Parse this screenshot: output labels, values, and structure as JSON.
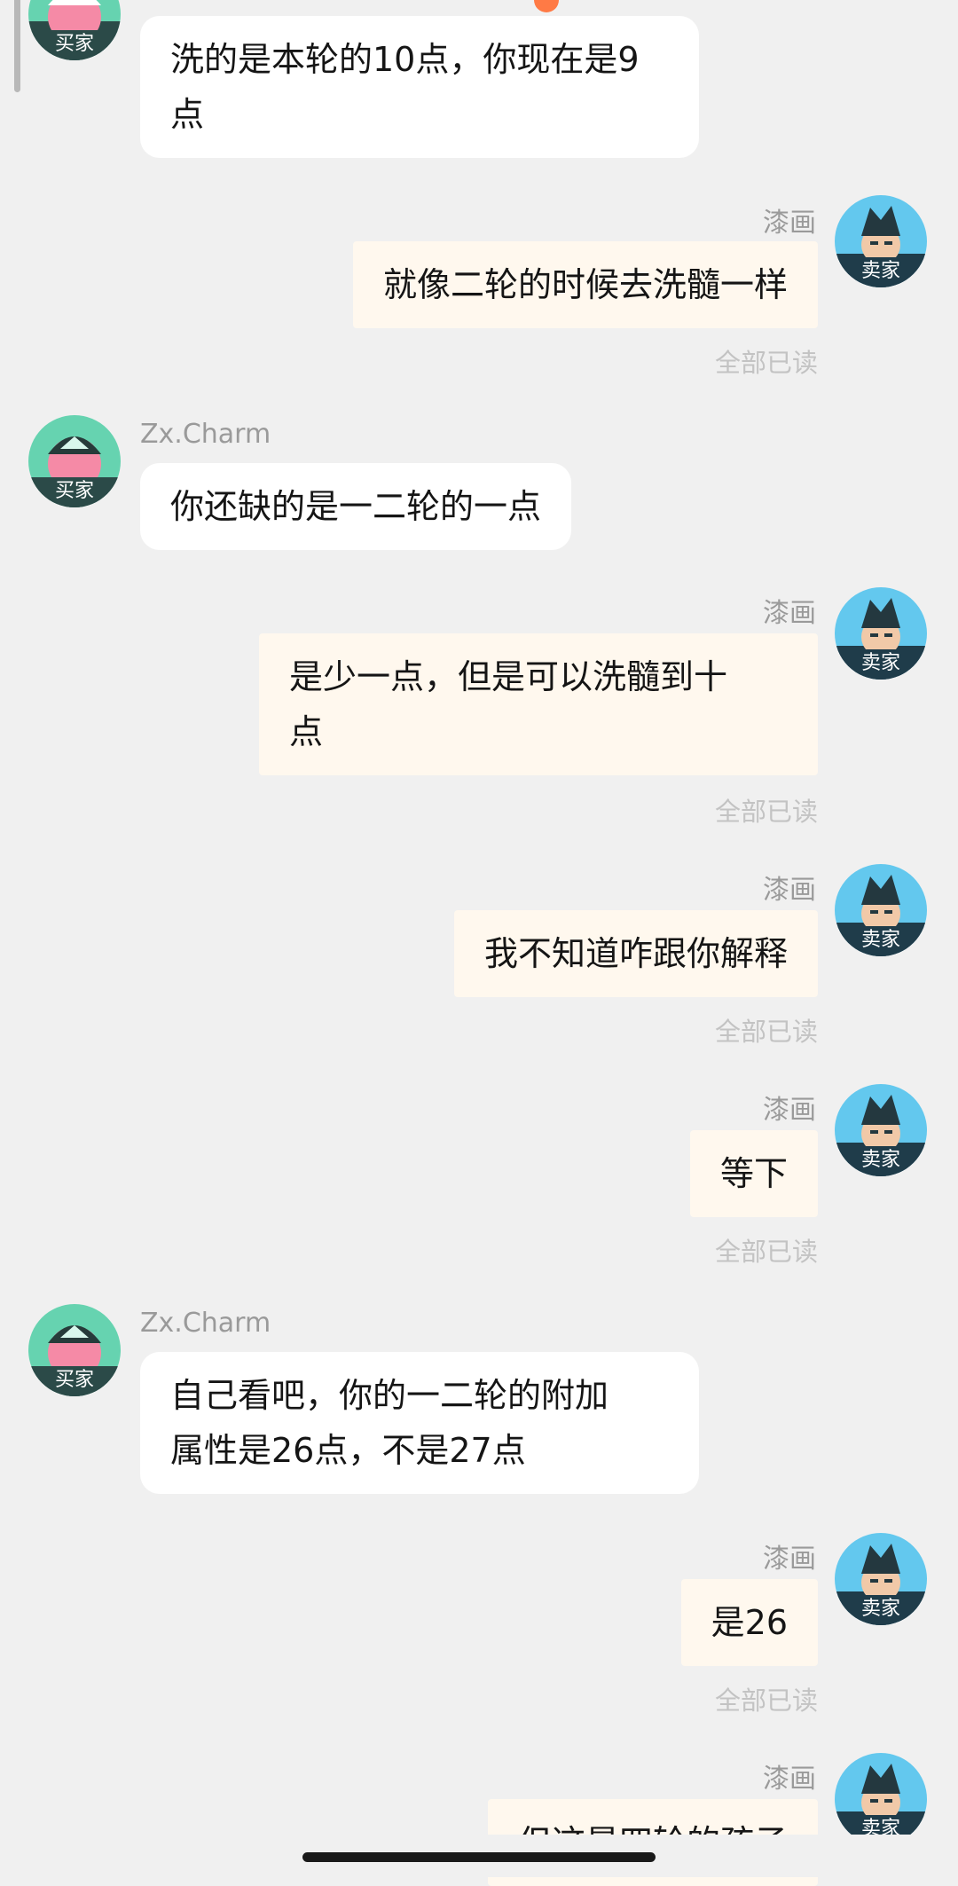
{
  "labels": {
    "buyer_badge": "买家",
    "seller_badge": "卖家",
    "read_status": "全部已读",
    "buyer_name": "Zx.Charm",
    "seller_name": "漆画"
  },
  "messages": [
    {
      "side": "in",
      "text": "洗的是本轮的10点，你现在是9\n点",
      "name": "",
      "read": ""
    },
    {
      "side": "out",
      "text": "就像二轮的时候去洗髓一样",
      "name": "漆画",
      "read": "全部已读"
    },
    {
      "side": "in",
      "text": "你还缺的是一二轮的一点",
      "name": "Zx.Charm",
      "read": ""
    },
    {
      "side": "out",
      "text": "是少一点，但是可以洗髓到十\n点",
      "name": "漆画",
      "read": "全部已读"
    },
    {
      "side": "out",
      "text": "我不知道咋跟你解释",
      "name": "漆画",
      "read": "全部已读"
    },
    {
      "side": "out",
      "text": "等下",
      "name": "漆画",
      "read": "全部已读"
    },
    {
      "side": "in",
      "text": "自己看吧，你的一二轮的附加\n属性是26点，不是27点",
      "name": "Zx.Charm",
      "read": ""
    },
    {
      "side": "out",
      "text": "是26",
      "name": "漆画",
      "read": "全部已读"
    },
    {
      "side": "out",
      "text": "但这是四轮的孩子",
      "name": "漆画",
      "read": ""
    }
  ],
  "colors": {
    "background": "#f0f0f0",
    "incoming_bubble": "#ffffff",
    "outgoing_bubble": "#fff8ee",
    "read_text": "#c3c3c3",
    "name_text": "#9a9a9a",
    "accent_dot": "#ff7a45"
  }
}
